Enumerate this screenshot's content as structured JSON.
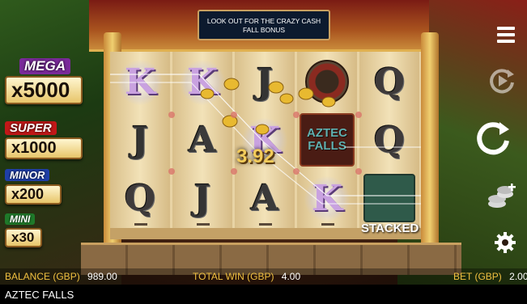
{
  "game": {
    "title": "AZTEC FALLS",
    "banner_text": "LOOK OUT FOR THE CRAZY CASH FALL BONUS",
    "win_amount": "3.92",
    "stacked_label": "STACKED"
  },
  "jackpots": {
    "mega": {
      "label": "MEGA",
      "value": "x5000"
    },
    "super": {
      "label": "SUPER",
      "value": "x1000"
    },
    "minor": {
      "label": "MINOR",
      "value": "x200"
    },
    "mini": {
      "label": "MINI",
      "value": "x30"
    }
  },
  "reels": [
    [
      "K",
      "J",
      "Q"
    ],
    [
      "K",
      "A",
      "J"
    ],
    [
      "J",
      "K",
      "A"
    ],
    [
      "wheel",
      "AZTEC FALLS",
      "K"
    ],
    [
      "Q",
      "Q",
      "stack"
    ]
  ],
  "status": {
    "balance_label": "BALANCE (GBP)",
    "balance_value": "989.00",
    "total_win_label": "TOTAL WIN (GBP)",
    "total_win_value": "4.00",
    "bet_label": "BET (GBP)",
    "bet_value": "2.00"
  },
  "controls": {
    "menu_icon": "hamburger-menu-icon",
    "replay_icon": "autoplay-icon",
    "spin_icon": "spin-icon",
    "stake_icon": "stake-coins-icon",
    "settings_icon": "gear-icon"
  },
  "colors": {
    "accent_gold": "#f0c040",
    "win_text": "#f4cc5a",
    "banner_bg": "#0c1a2e"
  }
}
